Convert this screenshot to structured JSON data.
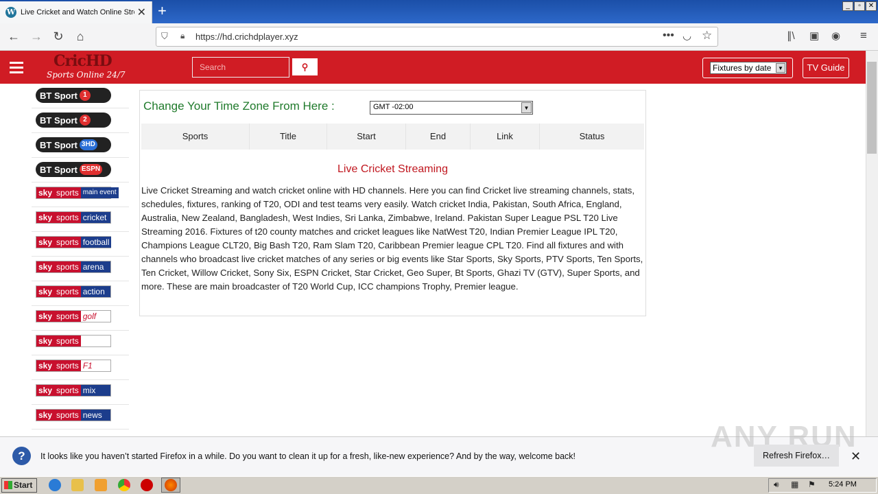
{
  "browser": {
    "tab_title": "Live Cricket and Watch Online Stre",
    "url": "https://hd.crichdplayer.xyz",
    "new_tab": "+",
    "win_buttons": [
      "_",
      "▫",
      "✕"
    ]
  },
  "site": {
    "logo_main": "CricHD",
    "logo_sub": "Sports Online 24/7",
    "search_placeholder": "Search",
    "fixtures_select": "Fixtures by date",
    "tv_guide": "TV Guide"
  },
  "sidebar": {
    "channels": [
      {
        "kind": "bt",
        "a": "BT Sport",
        "b": "1"
      },
      {
        "kind": "bt",
        "a": "BT Sport",
        "b": "2"
      },
      {
        "kind": "bt",
        "a": "BT Sport",
        "b": "3HD"
      },
      {
        "kind": "bt",
        "a": "BT Sport",
        "b": "ESPN"
      },
      {
        "kind": "sky",
        "a": "sky",
        "b": "sports",
        "c": "main event"
      },
      {
        "kind": "sky",
        "a": "sky",
        "b": "sports",
        "c": "cricket"
      },
      {
        "kind": "sky",
        "a": "sky",
        "b": "sports",
        "c": "football"
      },
      {
        "kind": "sky",
        "a": "sky",
        "b": "sports",
        "c": "arena"
      },
      {
        "kind": "sky",
        "a": "sky",
        "b": "sports",
        "c": "action"
      },
      {
        "kind": "sky",
        "a": "sky",
        "b": "sports",
        "c": "golf"
      },
      {
        "kind": "sky",
        "a": "sky",
        "b": "sports",
        "c": ""
      },
      {
        "kind": "sky",
        "a": "sky",
        "b": "sports",
        "c": "F1"
      },
      {
        "kind": "sky",
        "a": "sky",
        "b": "sports",
        "c": "mix"
      },
      {
        "kind": "sky",
        "a": "sky",
        "b": "sports",
        "c": "news"
      }
    ]
  },
  "main": {
    "timezone_label": "Change Your Time Zone From Here :",
    "timezone_value": "GMT -02:00",
    "table_headers": [
      "Sports",
      "Title",
      "Start",
      "End",
      "Link",
      "Status"
    ],
    "section_title": "Live Cricket Streaming",
    "description": "Live Cricket Streaming and watch cricket online with HD channels. Here you can find Cricket live streaming channels, stats, schedules, fixtures, ranking of T20, ODI and test teams very easily. Watch cricket India, Pakistan, South Africa, England, Australia, New Zealand, Bangladesh, West Indies, Sri Lanka, Zimbabwe, Ireland. Pakistan Super League PSL T20 Live Streaming 2016. Fixtures of t20 county matches and cricket leagues like NatWest T20, Indian Premier League IPL T20, Champions League CLT20, Big Bash T20, Ram Slam T20, Caribbean Premier league CPL T20. Find all fixtures and with channels who broadcast live cricket matches of any series or big events like Star Sports, Sky Sports, PTV Sports, Ten Sports, Ten Cricket, Willow Cricket, Sony Six, ESPN Cricket, Star Cricket, Geo Super, Bt Sports, Ghazi TV (GTV), Super Sports, and more. These are main broadcaster of T20 World Cup, ICC champions Trophy, Premier league."
  },
  "notification": {
    "message": "It looks like you haven’t started Firefox in a while. Do you want to clean it up for a fresh, like-new experience? And by the way, welcome back!",
    "button": "Refresh Firefox…",
    "close": "✕"
  },
  "watermark": "ANY RUN",
  "taskbar": {
    "start": "Start",
    "clock": "5:24 PM"
  }
}
